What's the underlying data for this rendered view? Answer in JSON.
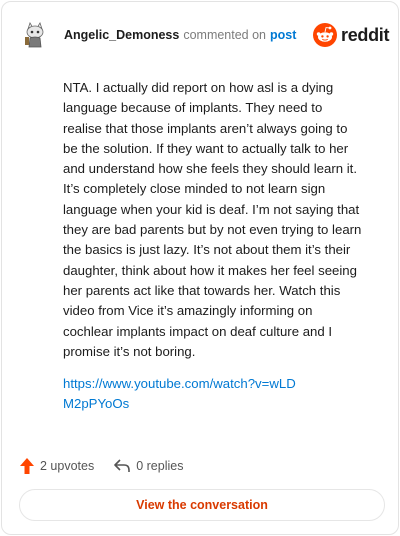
{
  "header": {
    "username": "Angelic_Demoness",
    "action_text": "commented on",
    "target_text": "post",
    "brand_word": "reddit"
  },
  "comment": {
    "body": "NTA. I actually did report on how asl is a dying language because of implants. They need to realise that those implants aren’t always going to be the solution. If they want to actually talk to her and understand how she feels they should learn it. It’s completely close minded to not learn sign language when your kid is deaf. I’m not saying that they are bad parents but by not even trying to learn the basics is just lazy. It’s not about them it’s their daughter, think about how it makes her feel seeing her parents act like that towards her. Watch this video from Vice it’s amazingly informing on cochlear implants impact on deaf culture and I promise it’s not boring.",
    "link": "https://www.youtube.com/watch?v=wLDM2pPYoOs"
  },
  "footer": {
    "upvotes": "2 upvotes",
    "replies": "0 replies",
    "view_button": "View the conversation"
  },
  "colors": {
    "brand_orange": "#ff4500",
    "link_blue": "#0079d3",
    "button_text": "#d93a00"
  },
  "icons": {
    "avatar": "snoo-avatar-icon",
    "brand": "reddit-logo-icon",
    "upvote": "upvote-arrow-icon",
    "reply": "reply-arrow-icon"
  }
}
